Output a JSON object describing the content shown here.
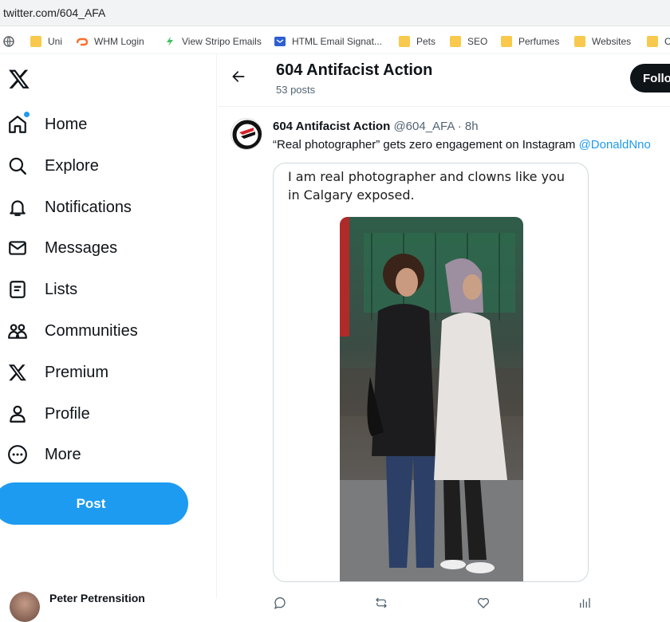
{
  "browser": {
    "url": "twitter.com/604_AFA",
    "bookmarks": [
      "Uni",
      "WHM Login",
      "View Stripo Emails",
      "HTML Email Signat...",
      "Pets",
      "SEO",
      "Perfumes",
      "Websites",
      "C"
    ]
  },
  "sidebar": {
    "items": [
      {
        "label": "Home",
        "icon": "home-icon"
      },
      {
        "label": "Explore",
        "icon": "search-icon"
      },
      {
        "label": "Notifications",
        "icon": "bell-icon"
      },
      {
        "label": "Messages",
        "icon": "envelope-icon"
      },
      {
        "label": "Lists",
        "icon": "list-icon"
      },
      {
        "label": "Communities",
        "icon": "people-icon"
      },
      {
        "label": "Premium",
        "icon": "x-logo-icon"
      },
      {
        "label": "Profile",
        "icon": "person-icon"
      },
      {
        "label": "More",
        "icon": "more-circle-icon"
      }
    ],
    "post_label": "Post",
    "account_name": "Peter Petrensition"
  },
  "header": {
    "title": "604 Antifacist Action",
    "post_count": "53 posts",
    "follow_label": "Follo"
  },
  "tweet": {
    "display_name": "604 Antifacist Action",
    "handle_time": "@604_AFA · 8h",
    "text": "“Real photographer” gets zero engagement on Instagram ",
    "mention": "@DonaldNno",
    "card_text": "I am real photographer and clowns like you in Calgary exposed."
  },
  "colors": {
    "accent": "#1d9bf0",
    "text": "#0f1419",
    "muted": "#536471"
  }
}
